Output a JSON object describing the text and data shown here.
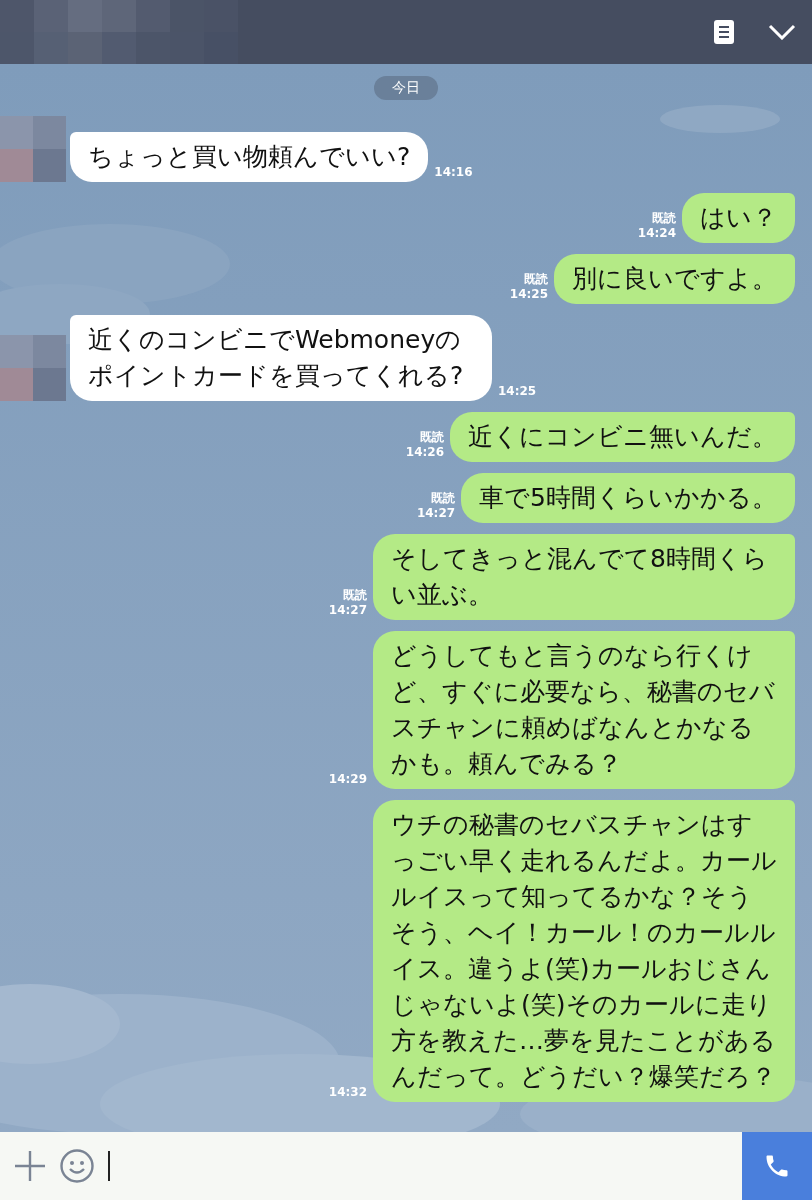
{
  "date_separator": "今日",
  "messages": [
    {
      "kind": "incoming",
      "text": "ちょっと買い物頼んでいい?",
      "time": "14:16"
    },
    {
      "kind": "outgoing",
      "text": "はい？",
      "read_label": "既読",
      "time": "14:24"
    },
    {
      "kind": "outgoing",
      "text": "別に良いですよ。",
      "read_label": "既読",
      "time": "14:25"
    },
    {
      "kind": "incoming",
      "text": "近くのコンビニでWebmoneyのポイントカードを買ってくれる?",
      "time": "14:25"
    },
    {
      "kind": "outgoing",
      "text": "近くにコンビニ無いんだ。",
      "read_label": "既読",
      "time": "14:26"
    },
    {
      "kind": "outgoing",
      "text": "車で5時間くらいかかる。",
      "read_label": "既読",
      "time": "14:27"
    },
    {
      "kind": "outgoing",
      "text": "そしてきっと混んでて8時間くらい並ぶ。",
      "read_label": "既読",
      "time": "14:27"
    },
    {
      "kind": "outgoing",
      "text": "どうしてもと言うのなら行くけど、すぐに必要なら、秘書のセバスチャンに頼めばなんとかなるかも。頼んでみる？",
      "time": "14:29"
    },
    {
      "kind": "outgoing",
      "text": "ウチの秘書のセバスチャンはすっごい早く走れるんだよ。カールルイスって知ってるかな？そうそう、ヘイ！カール！のカールルイス。違うよ(笑)カールおじさんじゃないよ(笑)そのカールに走り方を教えた…夢を見たことがあるんだって。どうだい？爆笑だろ？",
      "time": "14:32"
    }
  ]
}
